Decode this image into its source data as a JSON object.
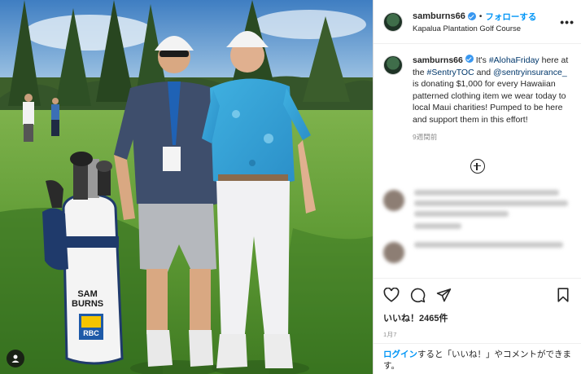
{
  "post": {
    "username": "samburns66",
    "follow_label": "フォローする",
    "location": "Kapalua Plantation Golf Course",
    "more_label": "•••"
  },
  "caption": {
    "username": "samburns66",
    "parts": {
      "t1": "It's ",
      "h1": "#AlohaFriday",
      "t2": " here at the ",
      "h2": "#SentryTOC",
      "t3": " and ",
      "m1": "@sentryinsurance_",
      "t4": " is donating $1,000 for every Hawaiian patterned clothing item we wear today to local Maui charities! Pumped to be here and support them in this effort!"
    },
    "time_ago": "9週間前"
  },
  "engagement": {
    "likes": "いいね！2465件",
    "posted_date": "1月7"
  },
  "login_prompt": {
    "login_link": "ログイン",
    "rest": "すると「いいね！」やコメントができます。"
  },
  "photo": {
    "bag_name_line1": "SAM",
    "bag_name_line2": "BURNS",
    "bag_logo": "RBC"
  },
  "colors": {
    "accent_blue": "#0095f6",
    "link_dark": "#00376b",
    "verified_blue": "#3897f0",
    "muted": "#8e8e8e"
  }
}
